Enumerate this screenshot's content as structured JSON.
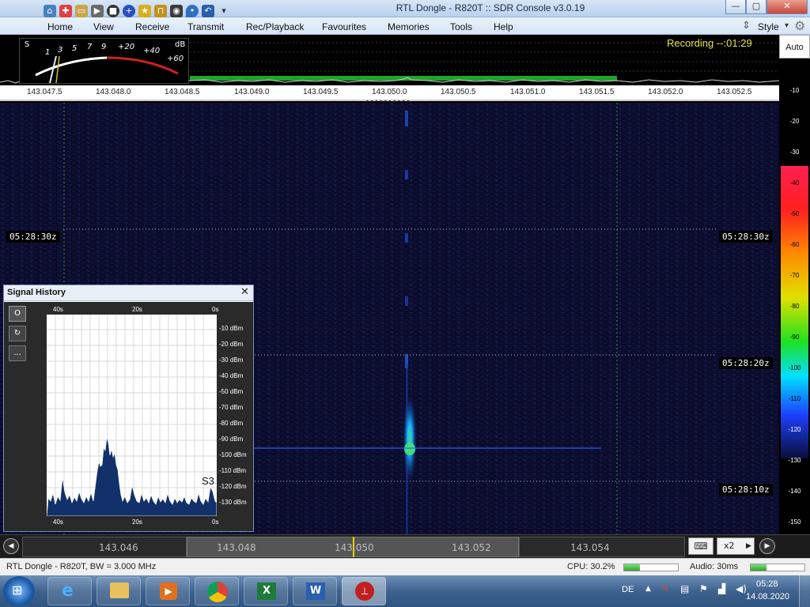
{
  "window": {
    "title": "RTL Dongle - R820T :: SDR Console v3.0.19"
  },
  "menu": {
    "items": [
      "Home",
      "View",
      "Receive",
      "Transmit",
      "Rec/Playback",
      "Favourites",
      "Memories",
      "Tools",
      "Help"
    ],
    "style_label": "Style"
  },
  "smeter": {
    "s_label": "S",
    "db_label": "dB",
    "scale": [
      "1",
      "3",
      "5",
      "7",
      "9"
    ],
    "plus_scale": [
      "+20",
      "+40",
      "+60"
    ]
  },
  "recording": {
    "text": "Recording --:01:29"
  },
  "freq_scale": {
    "ticks": [
      "143.047.5",
      "143.048.0",
      "143.048.5",
      "143.049.0",
      "143.049.5",
      "143.050.0",
      "143.050.5",
      "143.051.0",
      "143.051.5",
      "143.052.0",
      "143.052.5"
    ]
  },
  "right_panel": {
    "auto_label": "Auto",
    "db_levels": [
      "-10",
      "-20",
      "-30",
      "-40",
      "-50",
      "-60",
      "-70",
      "-80",
      "-90",
      "-100",
      "-110",
      "-120",
      "-130",
      "-140",
      "-150"
    ]
  },
  "timestamps": {
    "t1": "05:28:30z",
    "t2": "05:28:20z",
    "t3": "05:28:10z"
  },
  "signal_history": {
    "title": "Signal History",
    "top_time_labels": [
      "40s",
      "20s",
      "0s"
    ],
    "bottom_time_labels": [
      "40s",
      "20s",
      "0s"
    ],
    "dbm_labels": [
      "-10 dBm",
      "-20 dBm",
      "-30 dBm",
      "-40 dBm",
      "-50 dBm",
      "-70 dBm",
      "-80 dBm",
      "-90 dBm",
      "-100 dBm",
      "-110 dBm",
      "-120 dBm",
      "-130 dBm"
    ],
    "s_reading": "S3",
    "buttons": [
      "O",
      "↻",
      "..."
    ]
  },
  "tuning": {
    "labels": [
      "143.046",
      "143.048",
      "143.050",
      "143.052",
      "143.054"
    ],
    "zoom": "x2"
  },
  "status": {
    "device": "RTL Dongle - R820T, BW = 3.000 MHz",
    "cpu": "CPU: 30.2%",
    "audio": "Audio: 30ms",
    "cpu_level": 0.3,
    "audio_level": 0.3
  },
  "taskbar": {
    "lang": "DE",
    "time": "05:28",
    "date": "14.08.2020"
  },
  "colors": {
    "signal_peak": "#3fe07a",
    "signal_body": "#1f7fff",
    "recording": "#e5e24a",
    "waterfall_bg": "#0a0a2a"
  }
}
